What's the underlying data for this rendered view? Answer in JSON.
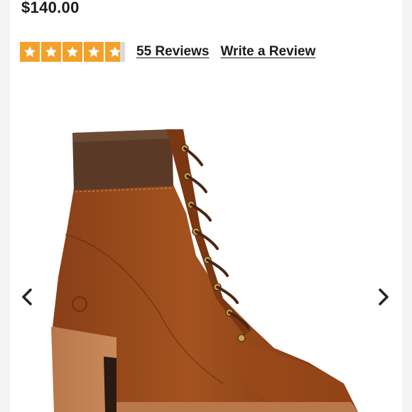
{
  "product": {
    "price": "$140.00"
  },
  "rating": {
    "stars": 4.5,
    "max_stars": 5,
    "star_color": "#f3a12b",
    "reviews_link": "55 Reviews",
    "write_review_link": "Write a Review"
  },
  "gallery": {
    "prev_icon": "chevron-left-icon",
    "next_icon": "chevron-right-icon",
    "image_subject": "brown leather lace-up heeled ankle boot"
  }
}
